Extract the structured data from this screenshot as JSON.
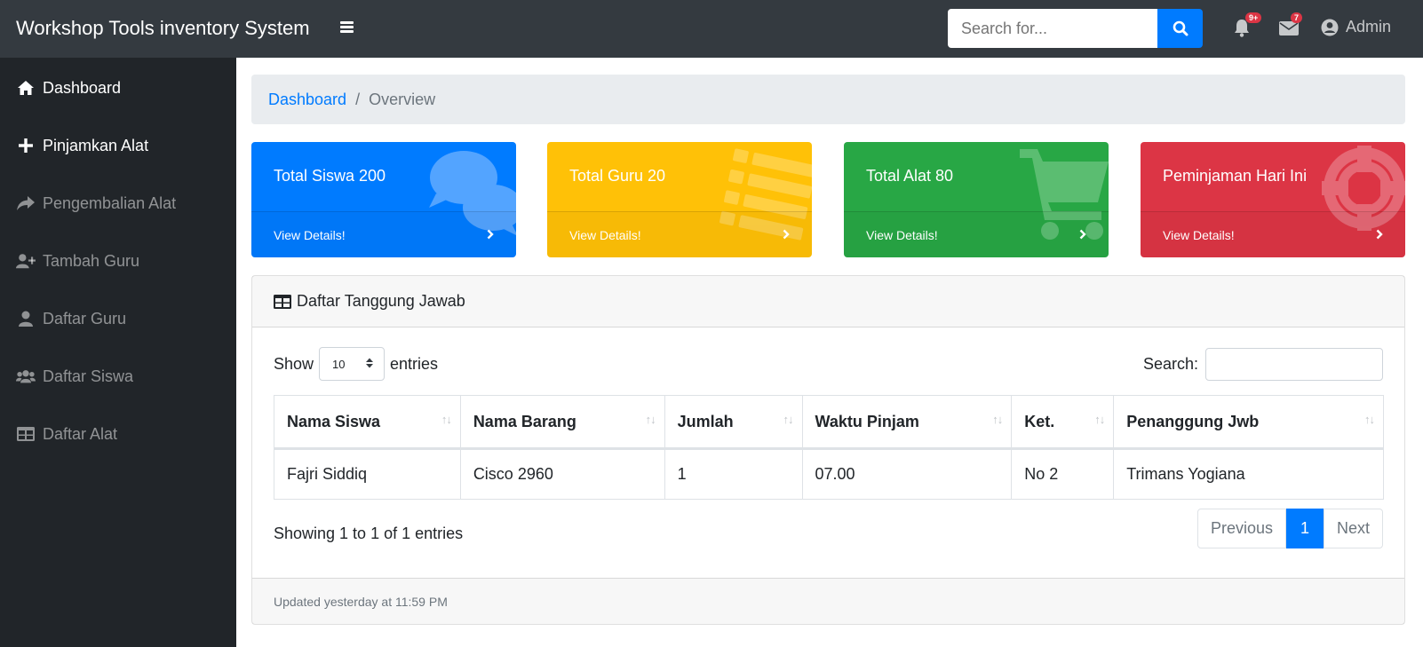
{
  "navbar": {
    "brand": "Workshop Tools inventory System",
    "search_placeholder": "Search for...",
    "alerts_badge": "9+",
    "messages_badge": "7",
    "user_label": "Admin"
  },
  "sidebar": {
    "items": [
      {
        "label": "Dashboard",
        "icon": "home-icon"
      },
      {
        "label": "Pinjamkan Alat",
        "icon": "plus-icon"
      },
      {
        "label": "Pengembalian Alat",
        "icon": "share-icon"
      },
      {
        "label": "Tambah Guru",
        "icon": "user-plus-icon"
      },
      {
        "label": "Daftar Guru",
        "icon": "user-icon"
      },
      {
        "label": "Daftar Siswa",
        "icon": "users-icon"
      },
      {
        "label": "Daftar Alat",
        "icon": "table-icon"
      }
    ]
  },
  "breadcrumb": {
    "root": "Dashboard",
    "current": "Overview"
  },
  "cards": [
    {
      "title": "Total Siswa 200",
      "link": "View Details!",
      "color": "#007bff",
      "icon": "comments-icon"
    },
    {
      "title": "Total Guru 20",
      "link": "View Details!",
      "color": "#ffc107",
      "icon": "list-icon"
    },
    {
      "title": "Total Alat 80",
      "link": "View Details!",
      "color": "#28a745",
      "icon": "shopping-cart-icon"
    },
    {
      "title": "Peminjaman Hari Ini",
      "link": "View Details!",
      "color": "#dc3545",
      "icon": "life-ring-icon"
    }
  ],
  "panel": {
    "title": "Daftar Tanggung Jawab",
    "show_label": "Show",
    "entries_value": "10",
    "entries_label": "entries",
    "search_label": "Search:",
    "columns": [
      "Nama Siswa",
      "Nama Barang",
      "Jumlah",
      "Waktu Pinjam",
      "Ket.",
      "Penanggung Jwb"
    ],
    "rows": [
      [
        "Fajri Siddiq",
        "Cisco 2960",
        "1",
        "07.00",
        "No 2",
        "Trimans Yogiana"
      ]
    ],
    "info": "Showing 1 to 1 of 1 entries",
    "pager": {
      "prev": "Previous",
      "page": "1",
      "next": "Next"
    },
    "footer": "Updated yesterday at 11:59 PM"
  }
}
